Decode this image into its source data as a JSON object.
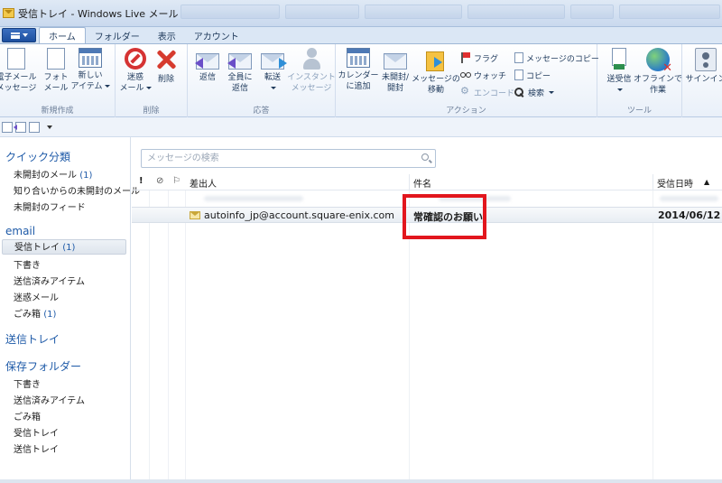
{
  "window": {
    "title": "受信トレイ - Windows Live メール"
  },
  "ribbon_tabs": [
    "ホーム",
    "フォルダー",
    "表示",
    "アカウント"
  ],
  "ribbon": {
    "groups": {
      "new": {
        "label": "新規作成",
        "email": [
          "電子メール",
          "メッセージ"
        ],
        "photo": [
          "フォト",
          "メール"
        ],
        "items": [
          "新しい",
          "アイテム"
        ]
      },
      "delete": {
        "label": "削除",
        "junk": [
          "迷惑",
          "メール"
        ],
        "delete": "削除"
      },
      "respond": {
        "label": "応答",
        "reply": "返信",
        "reply_all": [
          "全員に",
          "返信"
        ],
        "forward": "転送",
        "instant": [
          "インスタント",
          "メッセージ"
        ]
      },
      "actions": {
        "label": "アクション",
        "add_calendar": [
          "カレンダー",
          "に追加"
        ],
        "unread_read": [
          "未開封/",
          "開封"
        ],
        "move": [
          "メッセージの",
          "移動"
        ],
        "flag": "フラグ",
        "watch": "ウォッチ",
        "encode": "エンコード",
        "copy_message": "メッセージのコピー",
        "copy": "コピー",
        "find": "検索"
      },
      "tools": {
        "label": "ツール",
        "send_receive": "送受信",
        "offline": [
          "オフラインで",
          "作業"
        ]
      },
      "signin": "サインイン"
    }
  },
  "nav": {
    "quick_views": {
      "header": "クイック分類",
      "items": [
        {
          "label": "未開封のメール",
          "count": "(1)"
        },
        {
          "label": "知り合いからの未開封のメール",
          "count": ""
        },
        {
          "label": "未開封のフィード",
          "count": ""
        }
      ]
    },
    "email": {
      "header": "email",
      "items": [
        {
          "label": "受信トレイ",
          "count": "(1)",
          "selected": true
        },
        {
          "label": "下書き",
          "count": ""
        },
        {
          "label": "送信済みアイテム",
          "count": ""
        },
        {
          "label": "迷惑メール",
          "count": ""
        },
        {
          "label": "ごみ箱",
          "count": "(1)"
        }
      ]
    },
    "outbox": {
      "header": "送信トレイ"
    },
    "storage": {
      "header": "保存フォルダー",
      "items": [
        {
          "label": "下書き"
        },
        {
          "label": "送信済みアイテム"
        },
        {
          "label": "ごみ箱"
        },
        {
          "label": "受信トレイ"
        },
        {
          "label": "送信トレイ"
        }
      ]
    }
  },
  "message_list": {
    "search_placeholder": "メッセージの検索",
    "columns": {
      "importance": "!",
      "from": "差出人",
      "subject": "件名",
      "received": "受信日時"
    },
    "messages": [
      {
        "from": "autoinfo_jp@account.square-enix.com",
        "subject": "常確認のお願い",
        "received": "2014/06/12",
        "unread": true
      }
    ]
  },
  "colors": {
    "highlight_box": "#e2161d",
    "nav_header": "#1e5aa8",
    "ribbon_background": "#e9f0f9"
  }
}
